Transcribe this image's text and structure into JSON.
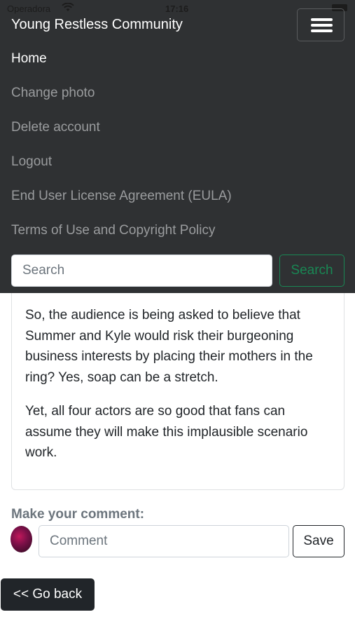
{
  "status_bar": {
    "carrier": "Operadora",
    "time": "17:16"
  },
  "navbar": {
    "brand": "Young Restless Community",
    "menu_icon": "hamburger-menu-icon",
    "links": [
      {
        "label": "Home",
        "active": true
      },
      {
        "label": "Change photo",
        "active": false
      },
      {
        "label": "Delete account",
        "active": false
      },
      {
        "label": "Logout",
        "active": false
      },
      {
        "label": "End User License Agreement (EULA)",
        "active": false
      },
      {
        "label": "Terms of Use and Copyright Policy",
        "active": false
      }
    ],
    "search": {
      "placeholder": "Search",
      "button_label": "Search"
    }
  },
  "article": {
    "paragraphs": [
      "So, the audience is being asked to believe that Summer and Kyle would risk their burgeoning business interests by placing their mothers in the ring? Yes, soap can be a stretch.",
      "Yet, all four actors are so good that fans can assume they will make this implausible scenario work."
    ]
  },
  "comment": {
    "label": "Make your comment:",
    "placeholder": "Comment",
    "save_label": "Save"
  },
  "go_back_label": "<< Go back",
  "colors": {
    "navbar_bg": "#2f3133",
    "success": "#198754",
    "dark": "#212529"
  }
}
